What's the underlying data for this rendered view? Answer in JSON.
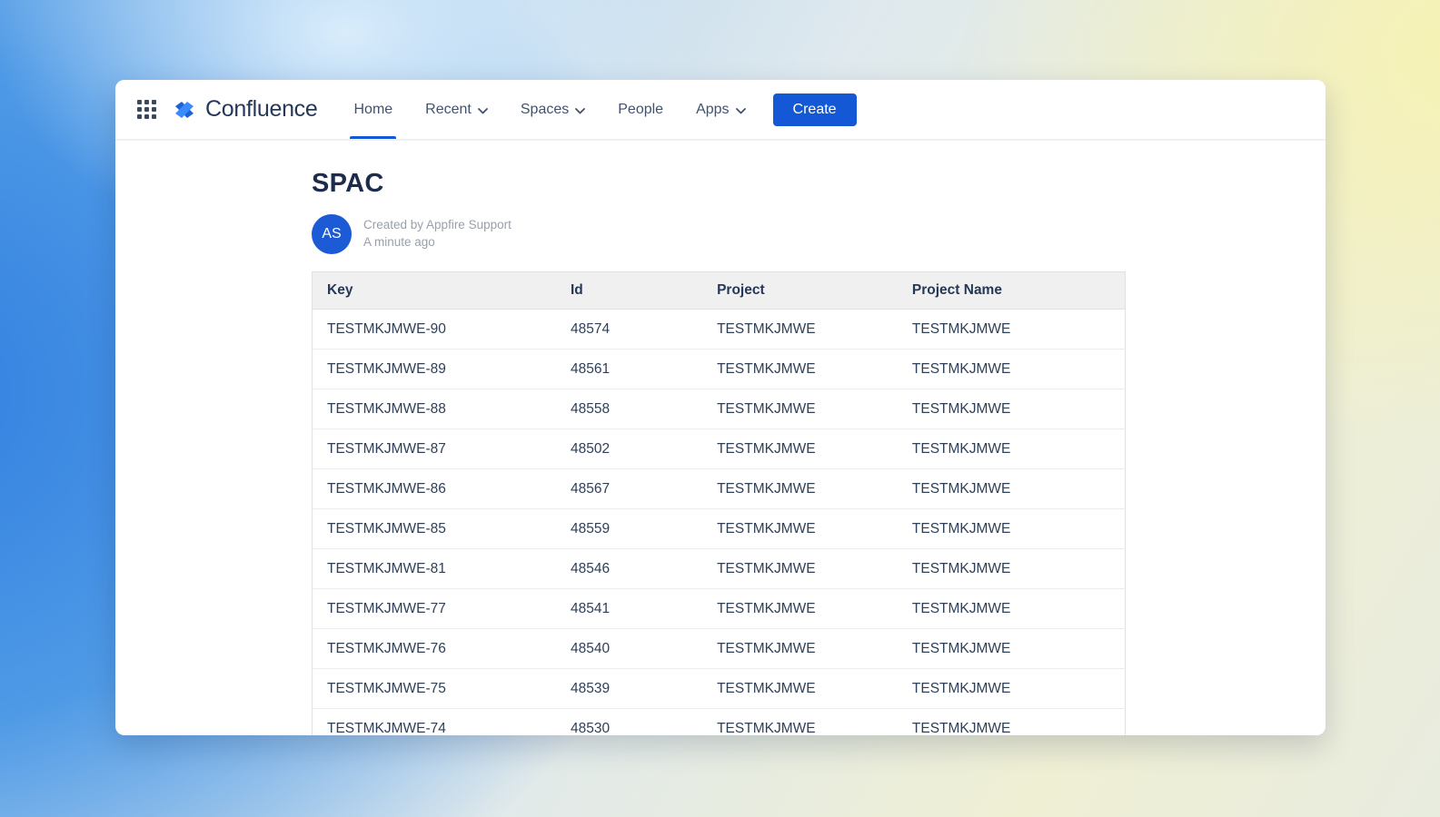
{
  "nav": {
    "logo": "Confluence",
    "items": [
      {
        "label": "Home",
        "chevron": false,
        "active": true
      },
      {
        "label": "Recent",
        "chevron": true,
        "active": false
      },
      {
        "label": "Spaces",
        "chevron": true,
        "active": false
      },
      {
        "label": "People",
        "chevron": false,
        "active": false
      },
      {
        "label": "Apps",
        "chevron": true,
        "active": false
      }
    ],
    "create_label": "Create"
  },
  "page": {
    "title": "SPAC",
    "avatar_initials": "AS",
    "created_by": "Created by Appfire Support",
    "timestamp": "A minute ago"
  },
  "table": {
    "columns": [
      "Key",
      "Id",
      "Project",
      "Project Name"
    ],
    "rows": [
      [
        "TESTMKJMWE-90",
        "48574",
        "TESTMKJMWE",
        "TESTMKJMWE"
      ],
      [
        "TESTMKJMWE-89",
        "48561",
        "TESTMKJMWE",
        "TESTMKJMWE"
      ],
      [
        "TESTMKJMWE-88",
        "48558",
        "TESTMKJMWE",
        "TESTMKJMWE"
      ],
      [
        "TESTMKJMWE-87",
        "48502",
        "TESTMKJMWE",
        "TESTMKJMWE"
      ],
      [
        "TESTMKJMWE-86",
        "48567",
        "TESTMKJMWE",
        "TESTMKJMWE"
      ],
      [
        "TESTMKJMWE-85",
        "48559",
        "TESTMKJMWE",
        "TESTMKJMWE"
      ],
      [
        "TESTMKJMWE-81",
        "48546",
        "TESTMKJMWE",
        "TESTMKJMWE"
      ],
      [
        "TESTMKJMWE-77",
        "48541",
        "TESTMKJMWE",
        "TESTMKJMWE"
      ],
      [
        "TESTMKJMWE-76",
        "48540",
        "TESTMKJMWE",
        "TESTMKJMWE"
      ],
      [
        "TESTMKJMWE-75",
        "48539",
        "TESTMKJMWE",
        "TESTMKJMWE"
      ],
      [
        "TESTMKJMWE-74",
        "48530",
        "TESTMKJMWE",
        "TESTMKJMWE"
      ]
    ]
  },
  "colors": {
    "accent": "#1558d6",
    "logo_dark": "#1c63d6",
    "logo_light": "#3b8bff",
    "navy_text": "#253858",
    "table_header_bg": "#f0f0f0",
    "muted_text": "#99a0ab"
  }
}
